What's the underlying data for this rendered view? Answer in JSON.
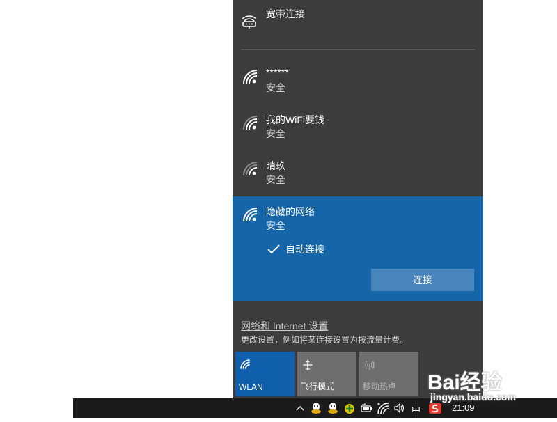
{
  "flyout": {
    "broadband": {
      "label": "宽带连接",
      "icon": "dialup-icon"
    },
    "networks": [
      {
        "name": "******",
        "status": "安全",
        "icon": "wifi-secure-icon"
      },
      {
        "name": "我的WiFi要钱",
        "status": "安全",
        "icon": "wifi-secure-icon"
      },
      {
        "name": "晴玖",
        "status": "安全",
        "icon": "wifi-secure-icon"
      }
    ],
    "selected_network": {
      "name": "隐藏的网络",
      "status": "安全",
      "icon": "wifi-secure-icon",
      "auto_connect_label": "自动连接",
      "auto_connect_checked": true,
      "connect_label": "连接"
    },
    "settings": {
      "link_label": "网络和 Internet 设置",
      "description": "更改设置，例如将某连接设置为按流量计费。"
    },
    "quick_actions": [
      {
        "label": "WLAN",
        "icon": "wifi-icon",
        "active": true
      },
      {
        "label": "飞行模式",
        "icon": "airplane-icon",
        "active": false
      },
      {
        "label": "移动热点",
        "icon": "hotspot-icon",
        "active": false
      }
    ]
  },
  "taskbar": {
    "input_method": "中",
    "clock": "21:09",
    "tray_icons": [
      "chevron-up-icon",
      "qq-icon",
      "qq-icon",
      "security-icon",
      "battery-icon",
      "wifi-icon",
      "volume-icon",
      "ime-indicator",
      "sogou-icon"
    ]
  },
  "watermark": {
    "brand": "Bai经验",
    "url": "jingyan.baidu.com"
  },
  "colors": {
    "flyout_bg": "#3c3c3c",
    "selected_bg": "#1565a8",
    "button_bg": "#4a86be",
    "tile_active": "#0f5fad",
    "tile_inactive": "#6e6e6e",
    "taskbar_bg": "#1b1b1b"
  }
}
